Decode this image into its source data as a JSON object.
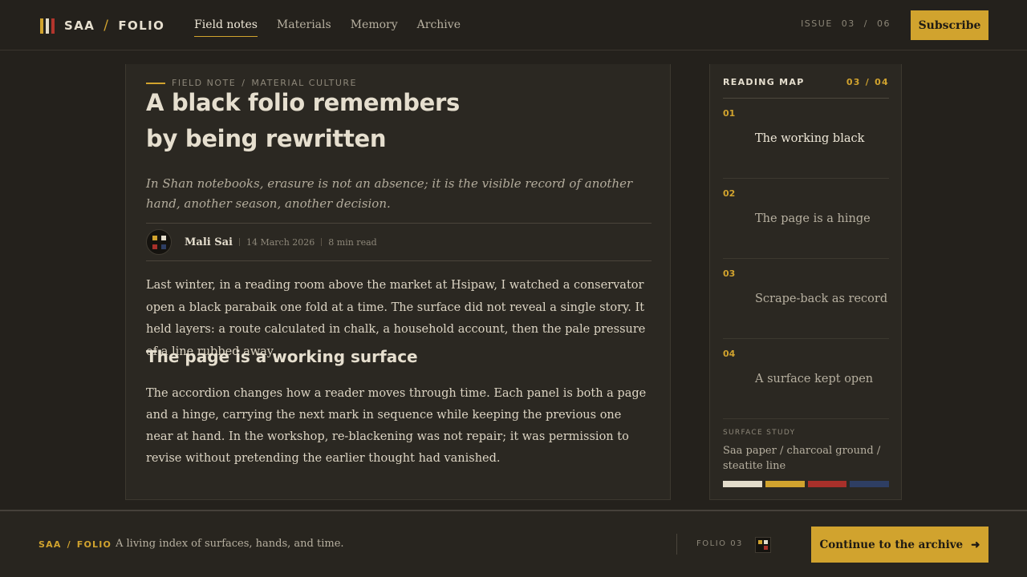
{
  "header": {
    "logo_left": "SAA",
    "logo_sep": "/",
    "logo_right": "FOLIO",
    "nav": [
      {
        "label": "Field notes",
        "active": true
      },
      {
        "label": "Materials"
      },
      {
        "label": "Memory"
      },
      {
        "label": "Archive"
      }
    ],
    "issue_label": "ISSUE",
    "issue_current": "03",
    "issue_sep": "/",
    "issue_total": "06",
    "subscribe_label": "Subscribe"
  },
  "article": {
    "kicker_section": "FIELD NOTE",
    "kicker_sep": "/",
    "kicker_topic": "MATERIAL CULTURE",
    "title_line1": "A black folio remembers",
    "title_line2": "by being rewritten",
    "dek": "In Shan notebooks, erasure is not an absence; it is the visible record of another hand, another season, another decision.",
    "author": "Mali Sai",
    "date": "14 March 2026",
    "read_time": "8 min read",
    "body_p1": "Last winter, in a reading room above the market at Hsipaw, I watched a conservator open a black parabaik one fold at a time. The surface did not reveal a single story. It held layers: a route calculated in chalk, a household account, then the pale pressure of a line rubbed away.",
    "subheading": "The page is a working surface",
    "body_p2": "The accordion changes how a reader moves through time. Each panel is both a page and a hinge, carrying the next mark in sequence while keeping the previous one near at hand. In the workshop, re-blackening was not repair; it was permission to revise without pretending the earlier thought had vanished."
  },
  "reading_map": {
    "title": "READING MAP",
    "current": "03",
    "sep": "/",
    "total": "04",
    "items": [
      {
        "num": "01",
        "label": "The working black",
        "current": true
      },
      {
        "num": "02",
        "label": "The page is a hinge"
      },
      {
        "num": "03",
        "label": "Scrape-back as record"
      },
      {
        "num": "04",
        "label": "A surface kept open"
      }
    ],
    "study_label": "SURFACE STUDY",
    "study_text": "Saa paper / charcoal ground / steatite line",
    "swatch_colors": [
      "#e3dccb",
      "#d1a32e",
      "#a8302a",
      "#2e3e63"
    ]
  },
  "footer": {
    "brand_left": "SAA",
    "brand_sep": "/",
    "brand_right": "FOLIO",
    "tagline": "A living index of surfaces, hands, and time.",
    "folio_label": "FOLIO 03",
    "continue_label": "Continue to the archive",
    "continue_arrow": "➜"
  },
  "colors": {
    "accent": "#d1a32e",
    "background": "#24211c",
    "panel": "#2b2822",
    "logo_bars": [
      "#d1a32e",
      "#e3dccb",
      "#b2352c"
    ],
    "mark_squares": [
      "#d1a32e",
      "#e3dccb",
      "#a8302a",
      "#2e3e63"
    ]
  }
}
